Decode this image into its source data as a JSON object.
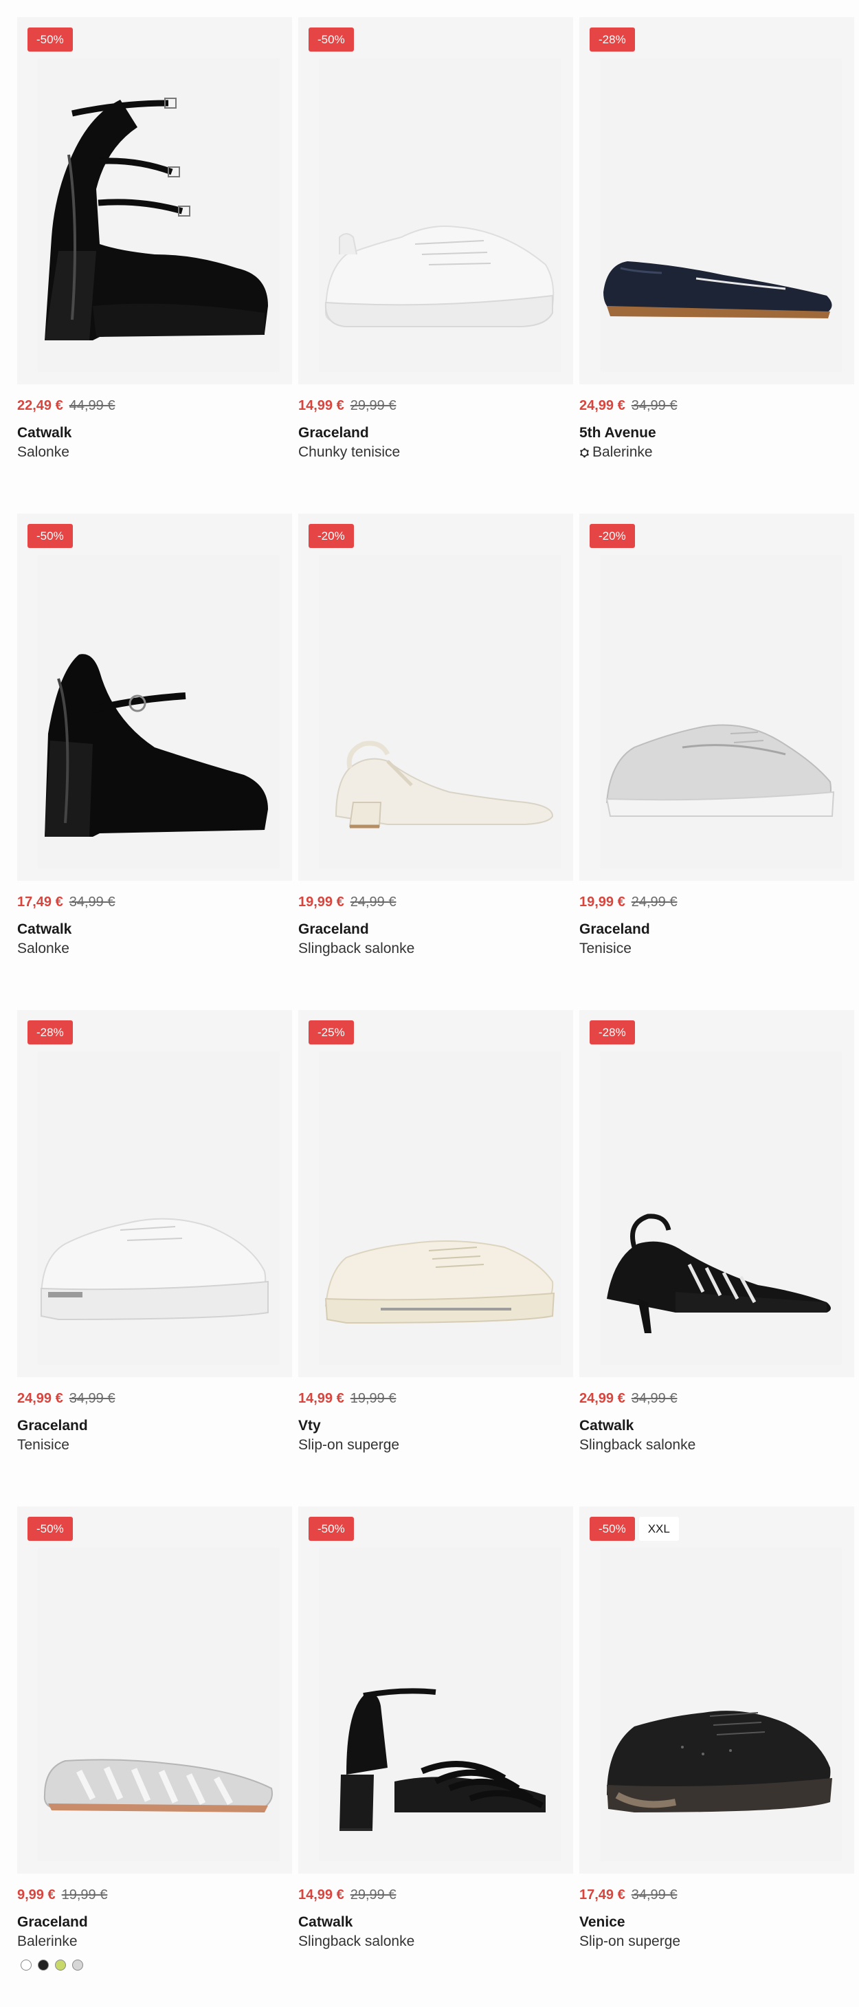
{
  "products": [
    {
      "badges": [
        "-50%"
      ],
      "price": "22,49 €",
      "old_price": "44,99 €",
      "brand": "Catwalk",
      "name": "Salonke",
      "shoe": "platform-mary-jane-black"
    },
    {
      "badges": [
        "-50%"
      ],
      "price": "14,99 €",
      "old_price": "29,99 €",
      "brand": "Graceland",
      "name": "Chunky tenisice",
      "shoe": "chunky-sneaker-white"
    },
    {
      "badges": [
        "-28%"
      ],
      "price": "24,99 €",
      "old_price": "34,99 €",
      "brand": "5th Avenue",
      "name": "Balerinke",
      "shoe": "loafer-navy",
      "sustainable_icon": true
    },
    {
      "badges": [
        "-50%"
      ],
      "price": "17,49 €",
      "old_price": "34,99 €",
      "brand": "Catwalk",
      "name": "Salonke",
      "shoe": "mary-jane-heel-black"
    },
    {
      "badges": [
        "-20%"
      ],
      "price": "19,99 €",
      "old_price": "24,99 €",
      "brand": "Graceland",
      "name": "Slingback salonke",
      "shoe": "slingback-cream"
    },
    {
      "badges": [
        "-20%"
      ],
      "price": "19,99 €",
      "old_price": "24,99 €",
      "brand": "Graceland",
      "name": "Tenisice",
      "shoe": "sneaker-silver"
    },
    {
      "badges": [
        "-28%"
      ],
      "price": "24,99 €",
      "old_price": "34,99 €",
      "brand": "Graceland",
      "name": "Tenisice",
      "shoe": "platform-sneaker-white"
    },
    {
      "badges": [
        "-25%"
      ],
      "price": "14,99 €",
      "old_price": "19,99 €",
      "brand": "Vty",
      "name": "Slip-on superge",
      "shoe": "canvas-sneaker-cream"
    },
    {
      "badges": [
        "-28%"
      ],
      "price": "24,99 €",
      "old_price": "34,99 €",
      "brand": "Catwalk",
      "name": "Slingback salonke",
      "shoe": "slingback-kitten-black"
    },
    {
      "badges": [
        "-50%"
      ],
      "price": "9,99 €",
      "old_price": "19,99 €",
      "brand": "Graceland",
      "name": "Balerinke",
      "shoe": "cutout-flat-silver",
      "swatches": [
        "#ffffff",
        "#222222",
        "#c8d86a",
        "#d6d6d6"
      ]
    },
    {
      "badges": [
        "-50%"
      ],
      "price": "14,99 €",
      "old_price": "29,99 €",
      "brand": "Catwalk",
      "name": "Slingback salonke",
      "shoe": "strappy-sandal-black"
    },
    {
      "badges": [
        "-50%",
        "XXL"
      ],
      "price": "17,49 €",
      "old_price": "34,99 €",
      "brand": "Venice",
      "name": "Slip-on superge",
      "shoe": "knit-sneaker-black"
    }
  ],
  "colors": {
    "sale": "#d9443d",
    "badge": "#e64545",
    "image_bg": "#f5f5f5"
  }
}
